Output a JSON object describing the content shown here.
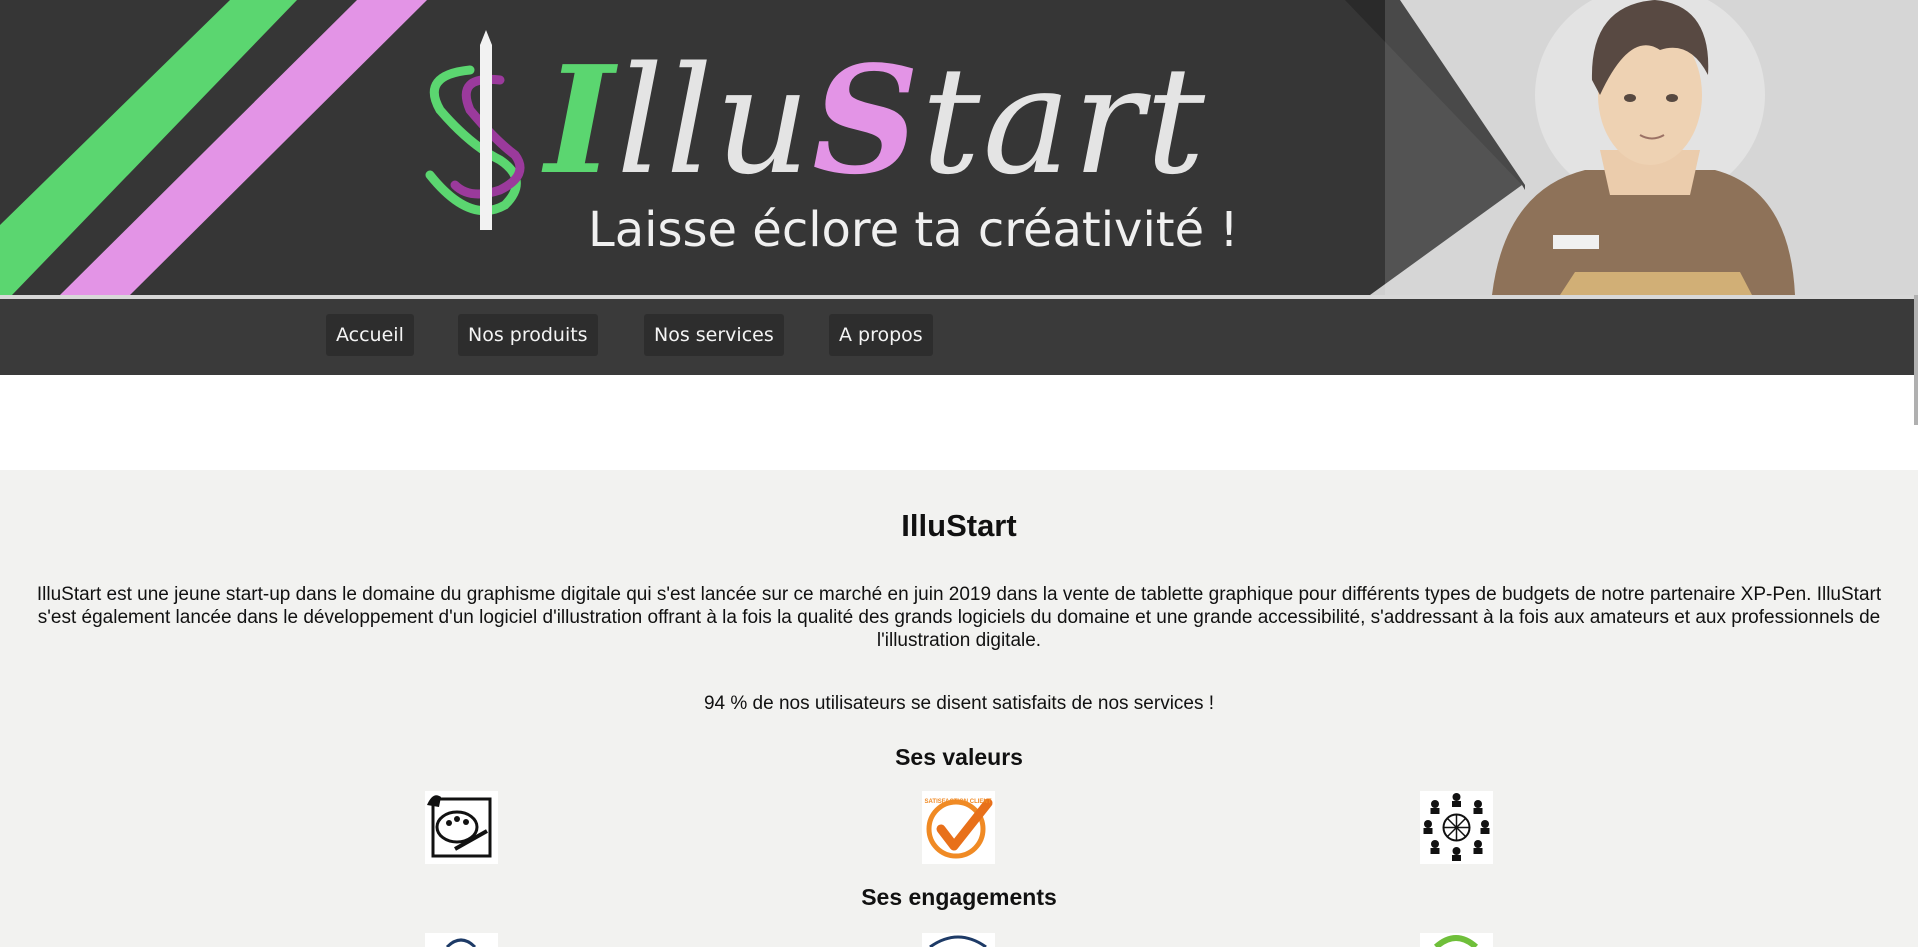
{
  "banner": {
    "logo_parts": [
      "I",
      "llu",
      "S",
      "tart"
    ],
    "tagline": "Laisse éclore ta créativité !",
    "colors": {
      "dark": "#363636",
      "green": "#5bd670",
      "pink": "#e394e6"
    }
  },
  "nav": {
    "items": [
      {
        "label": "Accueil"
      },
      {
        "label": "Nos produits"
      },
      {
        "label": "Nos services"
      },
      {
        "label": "A propos"
      }
    ]
  },
  "main": {
    "title": "IlluStart",
    "intro": "IlluStart est une jeune start-up dans le domaine du graphisme digitale qui s'est lancée sur ce marché en juin 2019 dans la vente de tablette graphique pour différents types de budgets de notre partenaire XP-Pen. IlluStart s'est également lancée dans le développement d'un logiciel d'illustration offrant à la fois la qualité des grands logiciels du domaine et une grande accessibilité, s'addressant à la fois aux amateurs et aux professionnels de l'illustration digitale.",
    "stat": "94 % de nos utilisateurs se disent satisfaits de nos services !",
    "values_title": "Ses valeurs",
    "values_icons": [
      "palette-icon",
      "satisfaction-check-icon",
      "team-network-icon"
    ],
    "badge_text": "SATISFACTION CLIENT",
    "engagements_title": "Ses engagements",
    "engagements_icons": [
      "engagement-icon-1",
      "engagement-icon-2",
      "engagement-icon-3"
    ]
  }
}
